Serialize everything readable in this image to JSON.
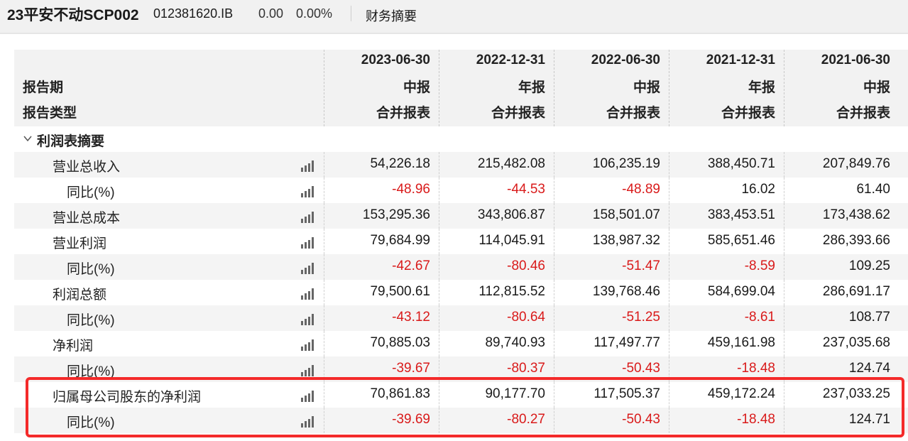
{
  "header": {
    "title": "23平安不动SCP002",
    "code": "012381620.IB",
    "price": "0.00",
    "change_pct": "0.00%",
    "section": "财务摘要"
  },
  "table": {
    "header_labels": {
      "period": "报告期",
      "type": "报告类型"
    },
    "columns": [
      {
        "date": "2023-06-30",
        "period": "中报",
        "type": "合并报表"
      },
      {
        "date": "2022-12-31",
        "period": "年报",
        "type": "合并报表"
      },
      {
        "date": "2022-06-30",
        "period": "中报",
        "type": "合并报表"
      },
      {
        "date": "2021-12-31",
        "period": "年报",
        "type": "合并报表"
      },
      {
        "date": "2021-06-30",
        "period": "中报",
        "type": "合并报表"
      }
    ],
    "section_title": "利润表摘要",
    "rows": [
      {
        "label": "营业总收入",
        "indent": 1,
        "values": [
          "54,226.18",
          "215,482.08",
          "106,235.19",
          "388,450.71",
          "207,849.76"
        ],
        "neg": [
          false,
          false,
          false,
          false,
          false
        ]
      },
      {
        "label": "同比(%)",
        "indent": 2,
        "values": [
          "-48.96",
          "-44.53",
          "-48.89",
          "16.02",
          "61.40"
        ],
        "neg": [
          true,
          true,
          true,
          false,
          false
        ]
      },
      {
        "label": "营业总成本",
        "indent": 1,
        "values": [
          "153,295.36",
          "343,806.87",
          "158,501.07",
          "383,453.51",
          "173,438.62"
        ],
        "neg": [
          false,
          false,
          false,
          false,
          false
        ]
      },
      {
        "label": "营业利润",
        "indent": 1,
        "values": [
          "79,684.99",
          "114,045.91",
          "138,987.32",
          "585,651.46",
          "286,393.66"
        ],
        "neg": [
          false,
          false,
          false,
          false,
          false
        ]
      },
      {
        "label": "同比(%)",
        "indent": 2,
        "values": [
          "-42.67",
          "-80.46",
          "-51.47",
          "-8.59",
          "109.25"
        ],
        "neg": [
          true,
          true,
          true,
          true,
          false
        ]
      },
      {
        "label": "利润总额",
        "indent": 1,
        "values": [
          "79,500.61",
          "112,815.52",
          "139,768.46",
          "584,699.04",
          "286,691.17"
        ],
        "neg": [
          false,
          false,
          false,
          false,
          false
        ]
      },
      {
        "label": "同比(%)",
        "indent": 2,
        "values": [
          "-43.12",
          "-80.64",
          "-51.25",
          "-8.61",
          "108.77"
        ],
        "neg": [
          true,
          true,
          true,
          true,
          false
        ]
      },
      {
        "label": "净利润",
        "indent": 1,
        "values": [
          "70,885.03",
          "89,740.93",
          "117,497.77",
          "459,161.98",
          "237,035.68"
        ],
        "neg": [
          false,
          false,
          false,
          false,
          false
        ]
      },
      {
        "label": "同比(%)",
        "indent": 2,
        "values": [
          "-39.67",
          "-80.37",
          "-50.43",
          "-18.48",
          "124.74"
        ],
        "neg": [
          true,
          true,
          true,
          true,
          false
        ]
      },
      {
        "label": "归属母公司股东的净利润",
        "indent": 1,
        "values": [
          "70,861.83",
          "90,177.70",
          "117,505.37",
          "459,172.24",
          "237,033.25"
        ],
        "neg": [
          false,
          false,
          false,
          false,
          false
        ]
      },
      {
        "label": "同比(%)",
        "indent": 2,
        "values": [
          "-39.69",
          "-80.27",
          "-50.43",
          "-18.48",
          "124.71"
        ],
        "neg": [
          true,
          true,
          true,
          true,
          false
        ]
      }
    ]
  },
  "colors": {
    "negative": "#d91a1a",
    "highlight": "#f42a2a"
  },
  "icons": {
    "row_chart": "bar-chart-icon",
    "section_toggle": "chevron-down-icon"
  }
}
